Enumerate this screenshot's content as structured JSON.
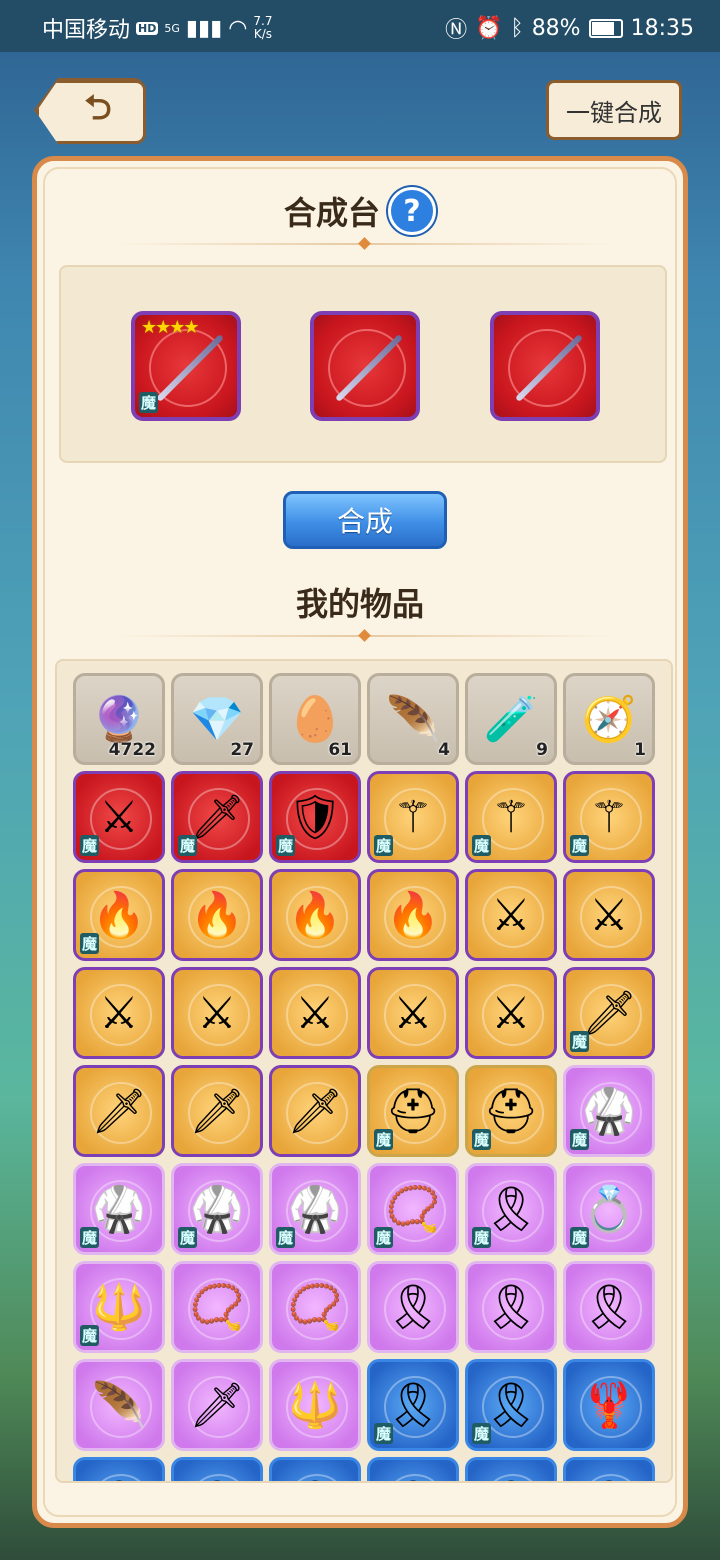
{
  "status_bar": {
    "carrier": "中国移动",
    "hd_badge": "HD",
    "network": "5G",
    "speed_value": "7.7",
    "speed_unit": "K/s",
    "battery_percent": "88%",
    "battery_level": 0.88,
    "time": "18:35"
  },
  "header": {
    "onekey_label": "一键合成"
  },
  "crafting": {
    "title": "合成台",
    "help_symbol": "?",
    "synth_label": "合成",
    "slots": [
      {
        "stars": "★★★★",
        "badge": "魔"
      },
      {
        "stars": "",
        "badge": ""
      },
      {
        "stars": "",
        "badge": ""
      }
    ]
  },
  "inventory": {
    "title": "我的物品",
    "badge_text": "魔",
    "materials": [
      {
        "count": "4722",
        "icon": "purple-orb-icon"
      },
      {
        "count": "27",
        "icon": "crystal-icon"
      },
      {
        "count": "61",
        "icon": "green-egg-icon"
      },
      {
        "count": "4",
        "icon": "golden-feather-icon"
      },
      {
        "count": "9",
        "icon": "potion-icon"
      },
      {
        "count": "1",
        "icon": "compass-icon"
      }
    ],
    "rows": [
      [
        {
          "quality": "red",
          "icon": "crossed-blades-icon",
          "badge": true
        },
        {
          "quality": "red",
          "icon": "purple-sword-icon",
          "badge": true
        },
        {
          "quality": "red",
          "icon": "shield-icon",
          "badge": true
        },
        {
          "quality": "gold",
          "icon": "orb-staff-icon",
          "badge": true
        },
        {
          "quality": "gold",
          "icon": "orb-staff-icon",
          "badge": true
        },
        {
          "quality": "gold",
          "icon": "orb-staff-icon",
          "badge": true
        }
      ],
      [
        {
          "quality": "gold",
          "icon": "flame-sword-icon",
          "badge": true
        },
        {
          "quality": "gold",
          "icon": "flame-sword-icon",
          "badge": false
        },
        {
          "quality": "gold",
          "icon": "flame-sword-icon",
          "badge": false
        },
        {
          "quality": "gold",
          "icon": "flame-sword-icon",
          "badge": false
        },
        {
          "quality": "gold",
          "icon": "crossed-blades-icon",
          "badge": false
        },
        {
          "quality": "gold",
          "icon": "crossed-blades-icon",
          "badge": false
        }
      ],
      [
        {
          "quality": "gold",
          "icon": "crossed-blades-icon",
          "badge": false
        },
        {
          "quality": "gold",
          "icon": "crossed-blades-icon",
          "badge": false
        },
        {
          "quality": "gold",
          "icon": "crossed-blades-icon",
          "badge": false
        },
        {
          "quality": "gold",
          "icon": "crossed-blades-icon",
          "badge": false
        },
        {
          "quality": "gold",
          "icon": "crossed-blades-icon",
          "badge": false
        },
        {
          "quality": "gold",
          "icon": "purple-sword-icon",
          "badge": true
        }
      ],
      [
        {
          "quality": "gold",
          "icon": "purple-sword-icon",
          "badge": false
        },
        {
          "quality": "gold",
          "icon": "purple-sword-icon",
          "badge": false
        },
        {
          "quality": "gold",
          "icon": "purple-sword-icon",
          "badge": false
        },
        {
          "quality": "gold2",
          "icon": "helmet-icon",
          "badge": true
        },
        {
          "quality": "gold2",
          "icon": "helmet-icon",
          "badge": true
        },
        {
          "quality": "purple",
          "icon": "armor-icon",
          "badge": true
        }
      ],
      [
        {
          "quality": "purple",
          "icon": "armor-icon",
          "badge": true
        },
        {
          "quality": "purple",
          "icon": "armor-icon",
          "badge": true
        },
        {
          "quality": "purple",
          "icon": "armor-icon",
          "badge": true
        },
        {
          "quality": "purple",
          "icon": "fang-necklace-icon",
          "badge": true
        },
        {
          "quality": "purple",
          "icon": "red-belt-icon",
          "badge": true
        },
        {
          "quality": "purple",
          "icon": "crystal-ring-icon",
          "badge": true
        }
      ],
      [
        {
          "quality": "purple",
          "icon": "crystal-staff-icon",
          "badge": true
        },
        {
          "quality": "purple",
          "icon": "fang-necklace-icon",
          "badge": false
        },
        {
          "quality": "purple",
          "icon": "fang-necklace-icon",
          "badge": false
        },
        {
          "quality": "purple",
          "icon": "red-belt-icon",
          "badge": false
        },
        {
          "quality": "purple",
          "icon": "red-belt-icon",
          "badge": false
        },
        {
          "quality": "purple",
          "icon": "red-belt-icon",
          "badge": false
        }
      ],
      [
        {
          "quality": "purple",
          "icon": "feather-blade-icon",
          "badge": false
        },
        {
          "quality": "purple",
          "icon": "leaf-sword-icon",
          "badge": false
        },
        {
          "quality": "purple",
          "icon": "crystal-staff-icon",
          "badge": false
        },
        {
          "quality": "blue",
          "icon": "red-belt-icon",
          "badge": true
        },
        {
          "quality": "blue",
          "icon": "red-belt-icon",
          "badge": true
        },
        {
          "quality": "blue",
          "icon": "red-claw-icon",
          "badge": false
        }
      ],
      [
        {
          "quality": "blue",
          "icon": "red-belt-icon",
          "badge": false
        },
        {
          "quality": "blue",
          "icon": "red-belt-icon",
          "badge": false
        },
        {
          "quality": "blue",
          "icon": "red-belt-icon",
          "badge": false
        },
        {
          "quality": "blue",
          "icon": "red-belt-icon",
          "badge": false
        },
        {
          "quality": "blue",
          "icon": "red-belt-icon",
          "badge": false
        },
        {
          "quality": "blue",
          "icon": "red-belt-icon",
          "badge": false
        }
      ]
    ]
  },
  "colors": {
    "panel_border": "#d78a4a",
    "panel_bg": "#fbf4e4",
    "synth_button": "#3f8fe6",
    "red_quality": "#c8161e",
    "gold_quality": "#e8a63a",
    "purple_quality": "#cf79ec",
    "blue_quality": "#2565c8"
  }
}
